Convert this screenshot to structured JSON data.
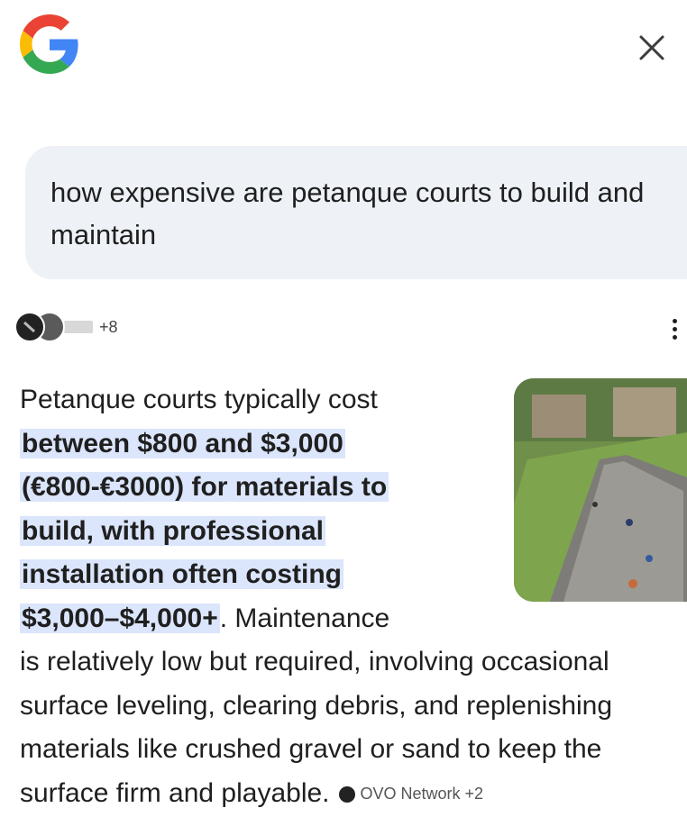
{
  "header": {
    "logo_icon": "google-g-logo",
    "close_icon": "close-icon"
  },
  "query": {
    "text": "how expensive are petanque courts to build and maintain"
  },
  "sources": {
    "count_label": "+8",
    "more_icon": "more-vert-icon"
  },
  "answer": {
    "line1": "Petanque courts typically cost",
    "hl1": "between $800 and $3,000",
    "hl2": "(€800-€3000) for materials to",
    "hl3": "build, with professional",
    "hl4": "installation often costing",
    "hl5": "$3,000–$4,000+",
    "line6_rest": ". Maintenance",
    "line7": "is relatively low but required, involving occasional",
    "line8": "surface leveling, clearing debris, and replenishing",
    "line9": "materials like crushed gravel or sand to keep the",
    "line10": "surface firm and playable.",
    "citation": "OVO Network +2"
  },
  "colors": {
    "highlight": "#dbe5fb",
    "query_bg": "#eef1f6"
  }
}
